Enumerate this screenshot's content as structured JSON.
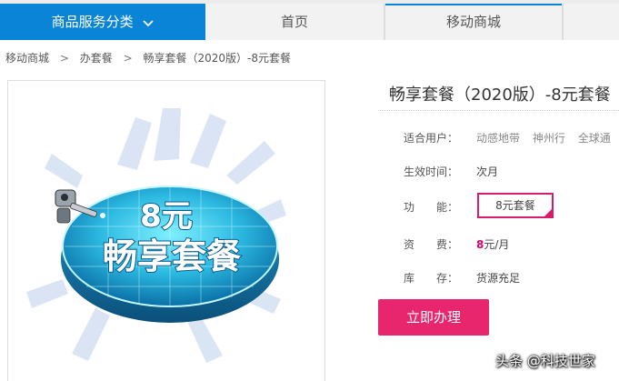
{
  "nav": {
    "category_label": "商品服务分类",
    "home_label": "首页",
    "mall_label": "移动商城",
    "accent": "#0a84d6"
  },
  "breadcrumb": {
    "items": [
      "移动商城",
      "办套餐",
      "畅享套餐（2020版）-8元套餐"
    ],
    "separator": ">"
  },
  "product": {
    "image_text_big": "8元",
    "image_text_main": "畅享套餐",
    "title": "畅享套餐（2020版）-8元套餐",
    "fields": {
      "users_label": "适合用户：",
      "users_options": [
        "动感地带",
        "神州行",
        "全球通"
      ],
      "effective_label": "生效时间：",
      "effective_value": "次月",
      "feature_label": "功　　能：",
      "feature_value": "8元套餐",
      "price_label": "资　　费：",
      "price_number": "8",
      "price_unit": "元/月",
      "stock_label": "库　　存：",
      "stock_value": "货源充足"
    },
    "buy_label": "立即办理",
    "price_color": "#e5006a"
  },
  "watermark": "头条 @科技世家"
}
